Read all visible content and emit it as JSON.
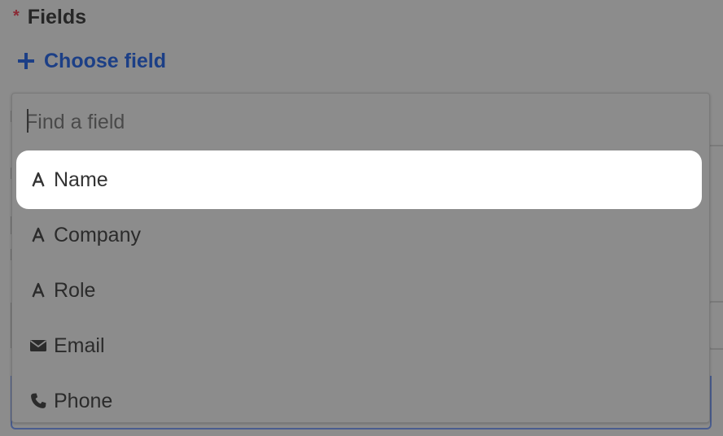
{
  "form": {
    "required_mark": "*",
    "section_title": "Fields",
    "choose_field_label": "Choose field"
  },
  "dropdown": {
    "search_placeholder": "Find a field",
    "search_value": "",
    "highlighted_index": 0,
    "options": [
      {
        "label": "Name",
        "icon": "text-type-icon"
      },
      {
        "label": "Company",
        "icon": "text-type-icon"
      },
      {
        "label": "Role",
        "icon": "text-type-icon"
      },
      {
        "label": "Email",
        "icon": "envelope-icon"
      },
      {
        "label": "Phone",
        "icon": "phone-icon"
      }
    ]
  },
  "colors": {
    "overlay_background": "#8c8c8c",
    "highlight_background": "#ffffff",
    "accent_link": "#1c3f86",
    "required_mark": "#8b2a35"
  }
}
